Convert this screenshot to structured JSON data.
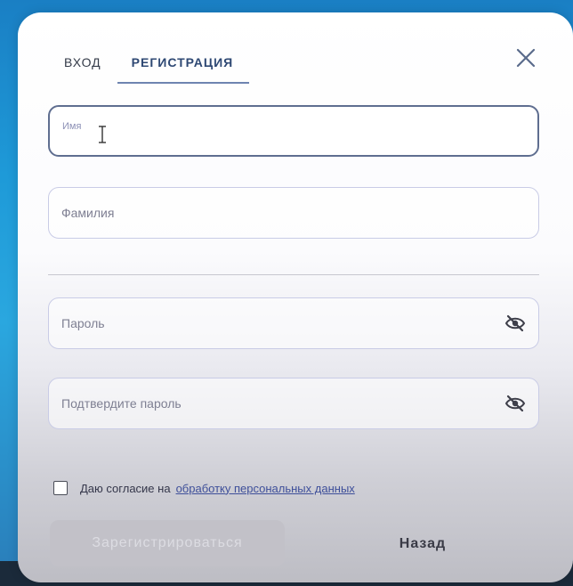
{
  "tabs": {
    "login": "ВХОД",
    "register": "РЕГИСТРАЦИЯ",
    "active": "register"
  },
  "form": {
    "first_name": {
      "label": "Имя",
      "value": ""
    },
    "last_name": {
      "label": "Фамилия",
      "value": ""
    },
    "password": {
      "label": "Пароль",
      "value": ""
    },
    "confirm_password": {
      "label": "Подтвердите пароль",
      "value": ""
    }
  },
  "consent": {
    "text": "Даю согласие на",
    "link_text": "обработку персональных данных",
    "checked": false
  },
  "buttons": {
    "register": "Зарегистрироваться",
    "back": "Назад"
  },
  "icons": {
    "close": "close-icon",
    "password_toggle": "eye-off-icon",
    "text_cursor": "text-cursor-icon"
  },
  "colors": {
    "accent": "#2e4873",
    "input_border": "#c9cce6",
    "link": "#3e4f9a"
  }
}
